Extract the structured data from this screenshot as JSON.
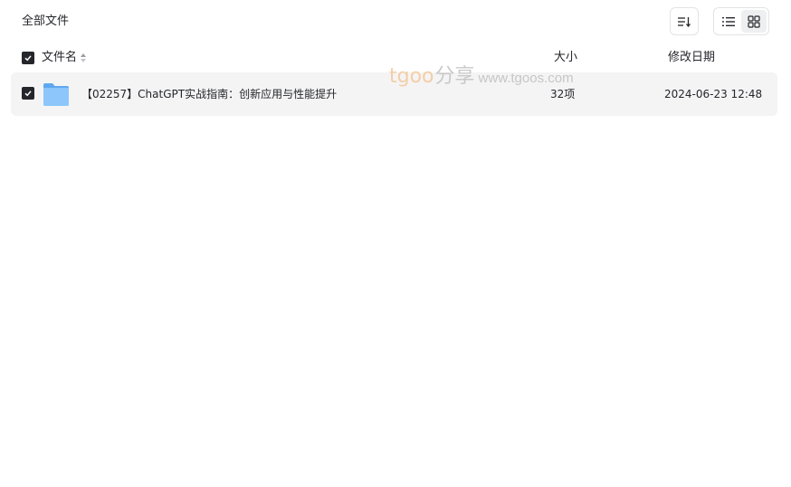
{
  "breadcrumb": {
    "root_label": "全部文件"
  },
  "toolbar": {
    "sort_icon": "sort-descending-icon",
    "list_view_icon": "list-view-icon",
    "grid_view_icon": "grid-view-icon",
    "active_view": "list"
  },
  "table": {
    "columns": {
      "name": "文件名",
      "size": "大小",
      "modified": "修改日期"
    },
    "select_all_checked": true,
    "rows": [
      {
        "checked": true,
        "icon": "folder-icon",
        "name": "【02257】ChatGPT实战指南：创新应用与性能提升",
        "size": "32项",
        "modified": "2024-06-23 12:48"
      }
    ]
  },
  "watermark": {
    "brand": "tgoo",
    "cn": "分享",
    "url": "www.tgoos.com"
  },
  "colors": {
    "text": "#25262b",
    "row_selected_bg": "#f4f4f5",
    "folder_blue": "#7cbcf6",
    "border": "#e2e3e6"
  }
}
